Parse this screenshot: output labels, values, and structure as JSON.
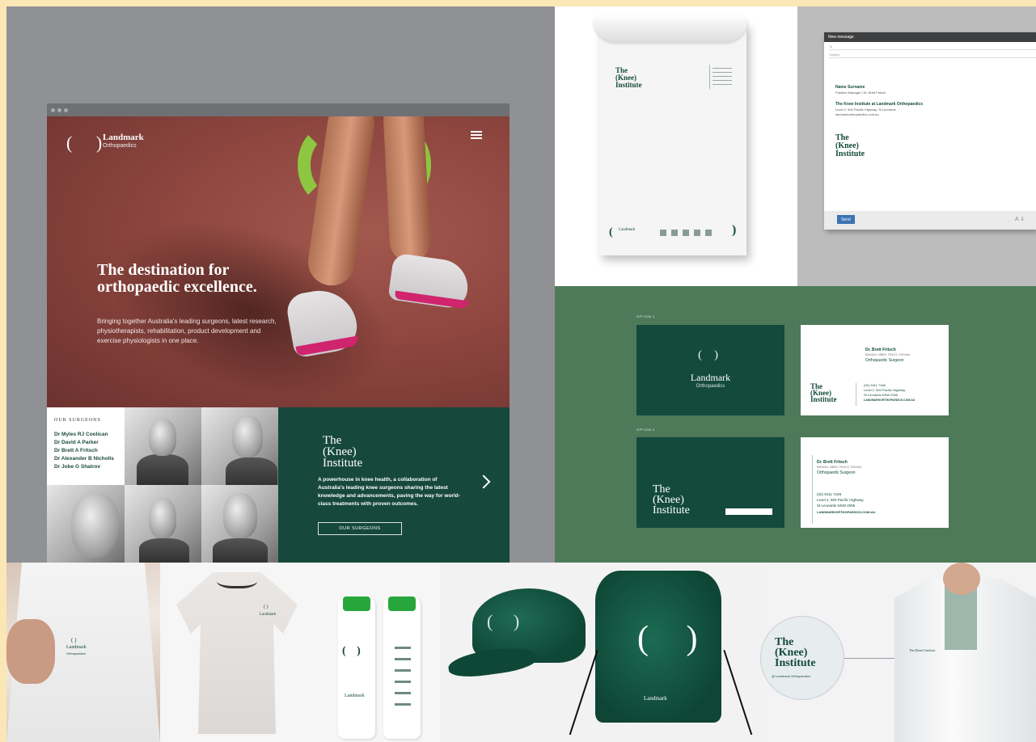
{
  "website": {
    "logo_mark": "( )",
    "logo_name": "Landmark",
    "logo_sub": "Orthopaedics",
    "hero_title_line1": "The destination for",
    "hero_title_line2": "orthopaedic excellence.",
    "hero_body": "Bringing together Australia's leading surgeons, latest research, physiotherapists, rehabilitation, product development and exercise physiologists in one place.",
    "surgeons_heading": "OUR SURGEONS",
    "surgeons": [
      "Dr Myles RJ Coolican",
      "Dr David A Parker",
      "Dr Brett A Fritsch",
      "Dr Alexander B Nicholls",
      "Dr Jobe G Shatrov"
    ],
    "knee_logo": [
      "The",
      "(Knee)",
      "Institute"
    ],
    "knee_body": "A powerhouse in knee health, a collaboration of Australia's leading knee surgeons sharing the latest knowledge and advancements, paving the way for world-class treatments with proven outcomes.",
    "knee_button": "OUR SURGEONS"
  },
  "letterhead": {
    "logo": [
      "The",
      "(Knee)",
      "Institute"
    ],
    "footer_logo": "Landmark"
  },
  "email": {
    "title": "New message",
    "to": "To",
    "subject": "Subject",
    "sig_name": "Name Surname",
    "sig_role": "Practice Manager  |  Dr. Brett Fritsch",
    "sig_org": "The Knee Institute at Landmark Orthopaedics",
    "sig_address": "Level 2, 500 Pacific Highway, St Leonards",
    "sig_web": "landmarkorthopaedics.com.au",
    "logo": [
      "The",
      "(Knee)",
      "Institute"
    ],
    "send": "Send",
    "tools": "A  ⇓"
  },
  "cards": {
    "option1": "OPTION 1",
    "option2": "OPTION 2",
    "card1_mark": "( )",
    "card1_name": "Landmark",
    "card1_sub": "Orthopaedics",
    "card_name": "Dr. Brett Fritsch",
    "card_quals": "BMedSci, MBBS, FRACS, FAOrthA",
    "card_title": "Orthopaedic Surgeon",
    "card_phone": "(02) 9411 7166",
    "card_address1": "Level 2, 500 Pacific Highway,",
    "card_address2": "St Leonards NSW 2065",
    "card_web": "LANDMARKORTHOPAEDICS.COM.AU",
    "knee_logo": [
      "The",
      "(Knee)",
      "Institute"
    ]
  },
  "merch": {
    "polo_mark": "( )",
    "polo_name": "Landmark",
    "polo_sub": "Orthopaedics",
    "bottle_mark": "( )",
    "bottle_name": "Landmark",
    "bag_mark": "( )",
    "bag_name": "Landmark",
    "badge_logo": [
      "The",
      "(Knee)",
      "Institute"
    ],
    "badge_sub": "@ Landmark Orthopaedics",
    "coat_logo": "The (Knee) Institute"
  },
  "colors": {
    "brand_green": "#134a3c",
    "accent_lime": "#8dc641",
    "board_green": "#4e7a5a",
    "hero_track": "#8e463f"
  }
}
